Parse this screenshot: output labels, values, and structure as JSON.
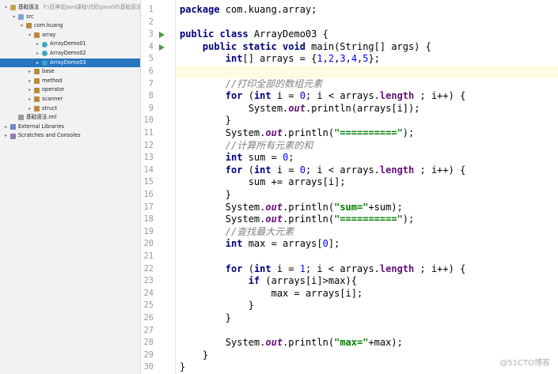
{
  "project_tree": {
    "items": [
      {
        "depth": 0,
        "expanded": true,
        "icon": "folder-icon",
        "label": "基础语法",
        "path": "F:\\狂神说Java课程\\代码\\JavaSE\\基础语法"
      },
      {
        "depth": 1,
        "expanded": true,
        "icon": "source-folder-icon",
        "label": "src"
      },
      {
        "depth": 2,
        "expanded": true,
        "icon": "package-icon",
        "label": "com.kuang"
      },
      {
        "depth": 3,
        "expanded": true,
        "icon": "package-icon",
        "label": "array"
      },
      {
        "depth": 4,
        "expanded": false,
        "icon": "class-icon",
        "label": "ArrayDemo01"
      },
      {
        "depth": 4,
        "expanded": false,
        "icon": "class-icon",
        "label": "ArrayDemo02"
      },
      {
        "depth": 4,
        "expanded": false,
        "icon": "class-icon",
        "label": "ArrayDemo03",
        "selected": true
      },
      {
        "depth": 3,
        "expanded": false,
        "icon": "package-icon",
        "label": "base"
      },
      {
        "depth": 3,
        "expanded": false,
        "icon": "package-icon",
        "label": "method"
      },
      {
        "depth": 3,
        "expanded": false,
        "icon": "package-icon",
        "label": "operator"
      },
      {
        "depth": 3,
        "expanded": false,
        "icon": "package-icon",
        "label": "scanner"
      },
      {
        "depth": 3,
        "expanded": false,
        "icon": "package-icon",
        "label": "struct"
      },
      {
        "depth": 1,
        "leaf": true,
        "icon": "module-file-icon",
        "label": "基础语法.iml"
      },
      {
        "depth": 0,
        "expanded": false,
        "icon": "libraries-icon",
        "label": "External Libraries"
      },
      {
        "depth": 0,
        "expanded": false,
        "icon": "scratches-icon",
        "label": "Scratches and Consoles"
      }
    ]
  },
  "editor": {
    "caret_line": 6,
    "run_markers": [
      3,
      4
    ],
    "lines": [
      [
        [
          "kw",
          "package"
        ],
        [
          "p",
          " com.kuang.array;"
        ]
      ],
      [],
      [
        [
          "kw",
          "public class"
        ],
        [
          "p",
          " ArrayDemo03 {"
        ]
      ],
      [
        [
          "p",
          "    "
        ],
        [
          "kw",
          "public static void"
        ],
        [
          "p",
          " main(String[] args) {"
        ]
      ],
      [
        [
          "p",
          "        "
        ],
        [
          "kw",
          "int"
        ],
        [
          "p",
          "[] arrays = {"
        ],
        [
          "num",
          "1"
        ],
        [
          "p",
          ","
        ],
        [
          "num",
          "2"
        ],
        [
          "p",
          ","
        ],
        [
          "num",
          "3"
        ],
        [
          "p",
          ","
        ],
        [
          "num",
          "4"
        ],
        [
          "p",
          ","
        ],
        [
          "num",
          "5"
        ],
        [
          "p",
          "};"
        ]
      ],
      [],
      [
        [
          "p",
          "        "
        ],
        [
          "cmt",
          "//打印全部的数组元素"
        ]
      ],
      [
        [
          "p",
          "        "
        ],
        [
          "kw",
          "for"
        ],
        [
          "p",
          " ("
        ],
        [
          "kw",
          "int"
        ],
        [
          "p",
          " i = "
        ],
        [
          "num",
          "0"
        ],
        [
          "p",
          "; i < arrays."
        ],
        [
          "fld",
          "length"
        ],
        [
          "p",
          " ; i++) {"
        ]
      ],
      [
        [
          "p",
          "            System."
        ],
        [
          "out",
          "out"
        ],
        [
          "p",
          ".println(arrays[i]);"
        ]
      ],
      [
        [
          "p",
          "        }"
        ]
      ],
      [
        [
          "p",
          "        System."
        ],
        [
          "out",
          "out"
        ],
        [
          "p",
          ".println("
        ],
        [
          "str",
          "\"==========\""
        ],
        [
          "p",
          ");"
        ]
      ],
      [
        [
          "p",
          "        "
        ],
        [
          "cmt",
          "//计算所有元素的和"
        ]
      ],
      [
        [
          "p",
          "        "
        ],
        [
          "kw",
          "int"
        ],
        [
          "p",
          " sum = "
        ],
        [
          "num",
          "0"
        ],
        [
          "p",
          ";"
        ]
      ],
      [
        [
          "p",
          "        "
        ],
        [
          "kw",
          "for"
        ],
        [
          "p",
          " ("
        ],
        [
          "kw",
          "int"
        ],
        [
          "p",
          " i = "
        ],
        [
          "num",
          "0"
        ],
        [
          "p",
          "; i < arrays."
        ],
        [
          "fld",
          "length"
        ],
        [
          "p",
          " ; i++) {"
        ]
      ],
      [
        [
          "p",
          "            sum += arrays[i];"
        ]
      ],
      [
        [
          "p",
          "        }"
        ]
      ],
      [
        [
          "p",
          "        System."
        ],
        [
          "out",
          "out"
        ],
        [
          "p",
          ".println("
        ],
        [
          "str",
          "\"sum=\""
        ],
        [
          "p",
          "+sum);"
        ]
      ],
      [
        [
          "p",
          "        System."
        ],
        [
          "out",
          "out"
        ],
        [
          "p",
          ".println("
        ],
        [
          "str",
          "\"==========\""
        ],
        [
          "p",
          ");"
        ]
      ],
      [
        [
          "p",
          "        "
        ],
        [
          "cmt",
          "//查找最大元素"
        ]
      ],
      [
        [
          "p",
          "        "
        ],
        [
          "kw",
          "int"
        ],
        [
          "p",
          " max = arrays["
        ],
        [
          "num",
          "0"
        ],
        [
          "p",
          "];"
        ]
      ],
      [],
      [
        [
          "p",
          "        "
        ],
        [
          "kw",
          "for"
        ],
        [
          "p",
          " ("
        ],
        [
          "kw",
          "int"
        ],
        [
          "p",
          " i = "
        ],
        [
          "num",
          "1"
        ],
        [
          "p",
          "; i < arrays."
        ],
        [
          "fld",
          "length"
        ],
        [
          "p",
          " ; i++) {"
        ]
      ],
      [
        [
          "p",
          "            "
        ],
        [
          "kw",
          "if"
        ],
        [
          "p",
          " (arrays[i]>max){"
        ]
      ],
      [
        [
          "p",
          "                max = arrays[i];"
        ]
      ],
      [
        [
          "p",
          "            }"
        ]
      ],
      [
        [
          "p",
          "        }"
        ]
      ],
      [],
      [
        [
          "p",
          "        System."
        ],
        [
          "out",
          "out"
        ],
        [
          "p",
          ".println("
        ],
        [
          "str",
          "\"max=\""
        ],
        [
          "p",
          "+max);"
        ]
      ],
      [
        [
          "p",
          "    }"
        ]
      ],
      [
        [
          "p",
          "}"
        ]
      ]
    ]
  },
  "watermark": "@51CTO博客"
}
